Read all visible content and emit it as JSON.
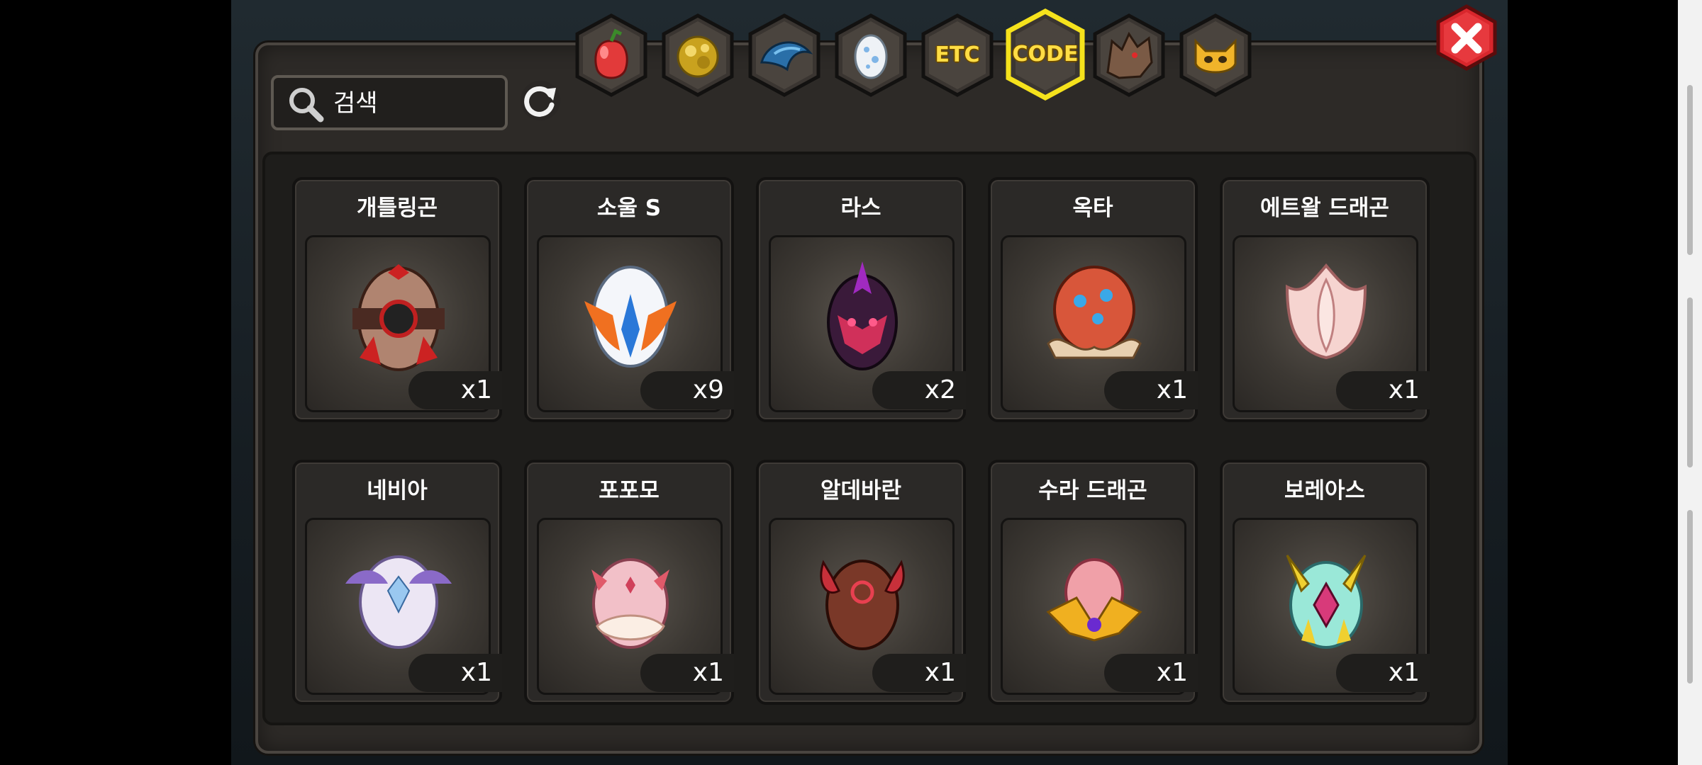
{
  "search": {
    "placeholder": "검색"
  },
  "tabs": [
    {
      "id": "fruit",
      "icon": "red-fruit-icon"
    },
    {
      "id": "gold",
      "icon": "gold-ore-icon"
    },
    {
      "id": "scale",
      "icon": "blue-scale-icon"
    },
    {
      "id": "egg",
      "icon": "egg-icon"
    },
    {
      "id": "etc",
      "label": "ETC"
    },
    {
      "id": "code",
      "label": "CODE",
      "active": true
    },
    {
      "id": "beast",
      "icon": "beast-head-icon"
    },
    {
      "id": "mask",
      "icon": "horned-mask-icon"
    }
  ],
  "items": [
    {
      "name": "개틀링곤",
      "qty": "x1",
      "icon": "gatlingon-egg-icon"
    },
    {
      "name": "소울 S",
      "qty": "x9",
      "icon": "soul-s-egg-icon"
    },
    {
      "name": "라스",
      "qty": "x2",
      "icon": "ras-egg-icon"
    },
    {
      "name": "옥타",
      "qty": "x1",
      "icon": "octa-egg-icon"
    },
    {
      "name": "에트왈 드래곤",
      "qty": "x1",
      "icon": "etoile-dragon-egg-icon"
    },
    {
      "name": "네비아",
      "qty": "x1",
      "icon": "nebia-egg-icon"
    },
    {
      "name": "포포모",
      "qty": "x1",
      "icon": "popomo-egg-icon"
    },
    {
      "name": "알데바란",
      "qty": "x1",
      "icon": "aldebaran-egg-icon"
    },
    {
      "name": "수라 드래곤",
      "qty": "x1",
      "icon": "sura-dragon-egg-icon"
    },
    {
      "name": "보레아스",
      "qty": "x1",
      "icon": "boreas-egg-icon"
    }
  ],
  "colors": {
    "active_tab_border": "#f5e21c",
    "panel": "#2d2a27",
    "close": "#d8262c"
  }
}
